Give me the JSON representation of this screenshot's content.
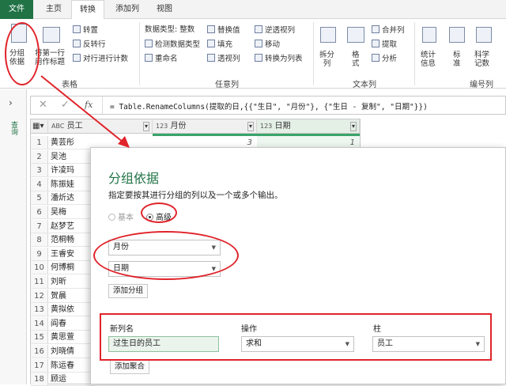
{
  "menu": {
    "file": "文件",
    "tabs": [
      "主页",
      "转换",
      "添加列",
      "视图"
    ]
  },
  "ribbon": {
    "group_by": "分组\n依据",
    "first_row_header": "将第一行\n用作标题",
    "table_group": "表格",
    "transpose": "转置",
    "reverse_rows": "反转行",
    "count_rows": "对行进行计数",
    "data_type": "数据类型: 整数",
    "detect_type": "检测数据类型",
    "rename": "重命名",
    "replace_values": "替换值",
    "fill": "填充",
    "pivot": "透视列",
    "unpivot": "逆透视列",
    "move": "移动",
    "to_list": "转换为列表",
    "any_column": "任意列",
    "split": "拆分\n列",
    "format": "格\n式",
    "merge_cols": "合并列",
    "extract": "提取",
    "parse": "分析",
    "text_column": "文本列",
    "statistics": "统计\n信息",
    "standard": "标\n准",
    "scientific": "科学\n记数",
    "number_column": "编号列"
  },
  "sidebar": {
    "label": "查询"
  },
  "formula": {
    "text": "= Table.RenameColumns(提取的日,{{\"生日\", \"月份\"}, {\"生日 - 复制\", \"日期\"}})"
  },
  "grid": {
    "columns": [
      {
        "type": "ABC",
        "name": "员工"
      },
      {
        "type": "123",
        "name": "月份"
      },
      {
        "type": "123",
        "name": "日期"
      }
    ],
    "first_row": {
      "month": "3",
      "day": "1"
    },
    "rows": [
      "黄芸彤",
      "吴池",
      "许凌玛",
      "陈振娃",
      "潘炘达",
      "吴梅",
      "赵梦艺",
      "范桐畅",
      "王睿安",
      "何博桐",
      "刘昕",
      "贺晨",
      "黄拟依",
      "阎春",
      "黄思萱",
      "刘晓倩",
      "陈运春",
      "顾运"
    ]
  },
  "dialog": {
    "title": "分组依据",
    "description": "指定要按其进行分组的列以及一个或多个输出。",
    "basic": "基本",
    "advanced": "高级",
    "group_fields": [
      "月份",
      "日期"
    ],
    "add_group": "添加分组",
    "col_new_name": "新列名",
    "col_operation": "操作",
    "col_column": "柱",
    "new_name_value": "过生日的员工",
    "operation_value": "求和",
    "column_value": "员工",
    "add_aggregation": "添加聚合"
  },
  "colors": {
    "accent": "#217346",
    "annotation": "#e0242b"
  }
}
